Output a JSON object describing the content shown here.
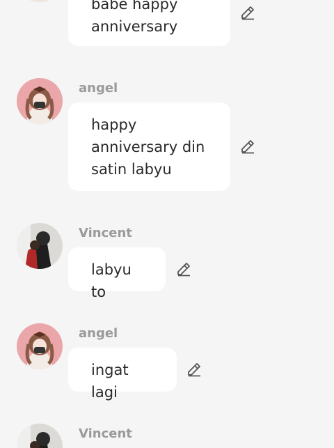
{
  "messages": [
    {
      "sender": "",
      "avatar": "angel-avatar",
      "text": "babe happy\nanniversary"
    },
    {
      "sender": "angel",
      "avatar": "angel-avatar",
      "text": "happy\nanniversary din\nsatin labyu"
    },
    {
      "sender": "Vincent",
      "avatar": "vincent-avatar",
      "text": "labyu to"
    },
    {
      "sender": "angel",
      "avatar": "angel-avatar",
      "text": "ingat lagi"
    },
    {
      "sender": "Vincent",
      "avatar": "vincent-avatar",
      "text": ""
    }
  ],
  "icons": {
    "edit": "pencil-icon"
  },
  "colors": {
    "background": "#f5f5f5",
    "bubble": "#ffffff",
    "sender": "#9a9a9a",
    "text": "#2a2a2a"
  }
}
